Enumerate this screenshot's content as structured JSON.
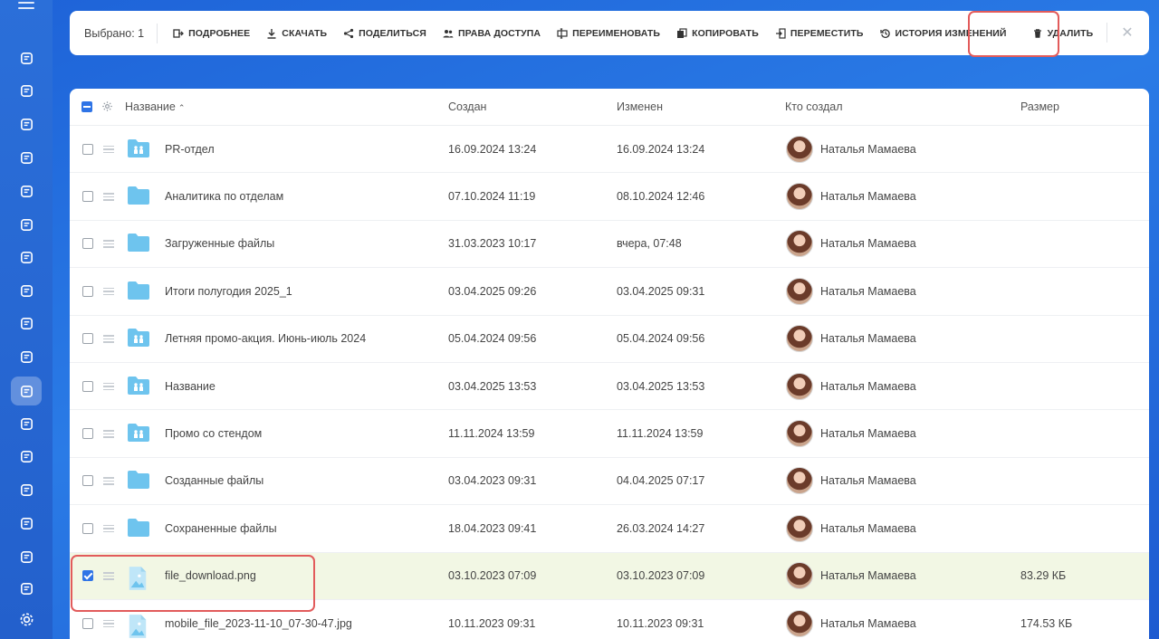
{
  "toolbar": {
    "selected_label": "Выбрано: 1",
    "buttons": [
      {
        "id": "details",
        "label": "ПОДРОБНЕЕ",
        "icon": "details-icon"
      },
      {
        "id": "download",
        "label": "СКАЧАТЬ",
        "icon": "download-icon"
      },
      {
        "id": "share",
        "label": "ПОДЕЛИТЬСЯ",
        "icon": "share-icon"
      },
      {
        "id": "access",
        "label": "ПРАВА ДОСТУПА",
        "icon": "users-icon"
      },
      {
        "id": "rename",
        "label": "ПЕРЕИМЕНОВАТЬ",
        "icon": "rename-icon"
      },
      {
        "id": "copy",
        "label": "КОПИРОВАТЬ",
        "icon": "copy-icon"
      },
      {
        "id": "move",
        "label": "ПЕРЕМЕСТИТЬ",
        "icon": "move-icon"
      },
      {
        "id": "history",
        "label": "ИСТОРИЯ ИЗМЕНЕНИЙ",
        "icon": "history-icon"
      },
      {
        "id": "delete",
        "label": "УДАЛИТЬ",
        "icon": "trash-icon"
      }
    ],
    "close_glyph": "✕"
  },
  "table": {
    "headers": {
      "name": "Название",
      "sort_glyph": "⌃",
      "created": "Создан",
      "modified": "Изменен",
      "author": "Кто создал",
      "size": "Размер"
    },
    "rows": [
      {
        "name": "PR-отдел",
        "type": "shared-folder",
        "created": "16.09.2024 13:24",
        "modified": "16.09.2024 13:24",
        "author": "Наталья Мамаева",
        "size": "",
        "checked": false
      },
      {
        "name": "Аналитика по отделам",
        "type": "folder",
        "created": "07.10.2024 11:19",
        "modified": "08.10.2024 12:46",
        "author": "Наталья Мамаева",
        "size": "",
        "checked": false
      },
      {
        "name": "Загруженные файлы",
        "type": "folder",
        "created": "31.03.2023 10:17",
        "modified": "вчера, 07:48",
        "author": "Наталья Мамаева",
        "size": "",
        "checked": false
      },
      {
        "name": "Итоги полугодия 2025_1",
        "type": "folder",
        "created": "03.04.2025 09:26",
        "modified": "03.04.2025 09:31",
        "author": "Наталья Мамаева",
        "size": "",
        "checked": false
      },
      {
        "name": "Летняя промо-акция. Июнь-июль 2024",
        "type": "shared-folder",
        "created": "05.04.2024 09:56",
        "modified": "05.04.2024 09:56",
        "author": "Наталья Мамаева",
        "size": "",
        "checked": false
      },
      {
        "name": "Название",
        "type": "shared-folder",
        "created": "03.04.2025 13:53",
        "modified": "03.04.2025 13:53",
        "author": "Наталья Мамаева",
        "size": "",
        "checked": false
      },
      {
        "name": "Промо со стендом",
        "type": "shared-folder",
        "created": "11.11.2024 13:59",
        "modified": "11.11.2024 13:59",
        "author": "Наталья Мамаева",
        "size": "",
        "checked": false
      },
      {
        "name": "Созданные файлы",
        "type": "folder",
        "created": "03.04.2023 09:31",
        "modified": "04.04.2025 07:17",
        "author": "Наталья Мамаева",
        "size": "",
        "checked": false
      },
      {
        "name": "Сохраненные файлы",
        "type": "folder",
        "created": "18.04.2023 09:41",
        "modified": "26.03.2024 14:27",
        "author": "Наталья Мамаева",
        "size": "",
        "checked": false
      },
      {
        "name": "file_download.png",
        "type": "image",
        "created": "03.10.2023 07:09",
        "modified": "03.10.2023 07:09",
        "author": "Наталья Мамаева",
        "size": "83.29 КБ",
        "checked": true
      },
      {
        "name": "mobile_file_2023-11-10_07-30-47.jpg",
        "type": "image",
        "created": "10.11.2023 09:31",
        "modified": "10.11.2023 09:31",
        "author": "Наталья Мамаева",
        "size": "174.53 КБ",
        "checked": false
      }
    ]
  },
  "colors": {
    "accent": "#2f74e6",
    "highlight_border": "#e25b5b",
    "selected_row": "#f2f7e4",
    "folder": "#6ec4ee"
  },
  "rail_icons": [
    "activity-icon",
    "edit-doc-icon",
    "document-icon",
    "list-icon",
    "filter-icon",
    "mail-icon",
    "task-icon",
    "target-icon",
    "id-card-icon",
    "file-icon",
    "drive-icon",
    "chat-icon",
    "robot-icon",
    "calendar-icon",
    "schedule-icon",
    "store-icon",
    "drive-2-icon",
    "settings-icon"
  ]
}
